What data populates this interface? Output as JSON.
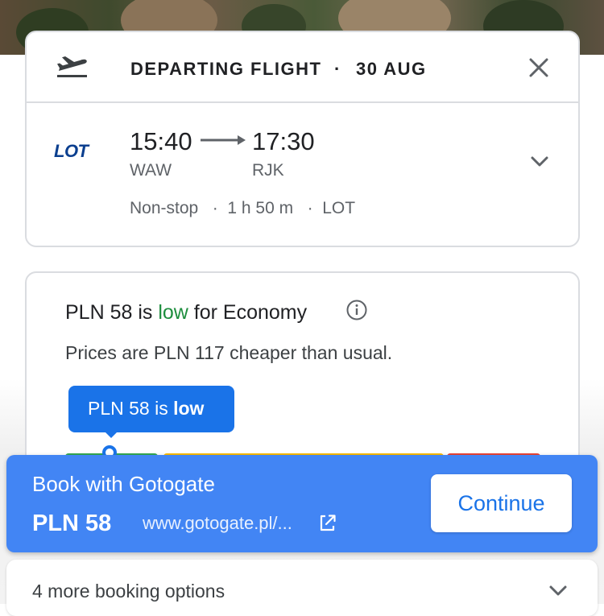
{
  "header": {
    "title": "DEPARTING FLIGHT",
    "separator": "·",
    "date": "30 AUG"
  },
  "flight": {
    "airline_logo_text": "LOT",
    "departure_time": "15:40",
    "arrival_time": "17:30",
    "departure_code": "WAW",
    "arrival_code": "RJK",
    "details": "Non-stop   ·  1 h 50 m   ·  LOT"
  },
  "price_insight": {
    "line1_prefix": "PLN 58 is ",
    "line1_status": "low",
    "line1_suffix": " for Economy",
    "line2": "Prices are PLN 117 cheaper than usual.",
    "tooltip_prefix": "PLN 58 is ",
    "tooltip_status": "low",
    "status_color": "#1e8e3e",
    "price_range_colors": [
      "#34a853",
      "#fbbc04",
      "#ea4335"
    ]
  },
  "booking": {
    "title": "Book with Gotogate",
    "price": "PLN 58",
    "url": "www.gotogate.pl/...",
    "continue_label": "Continue",
    "accent_color": "#4285f4"
  },
  "more_options": {
    "label": "4 more booking options"
  },
  "icons": {
    "departure": "flight-takeoff-icon",
    "close": "close-icon",
    "expand": "chevron-down-icon",
    "info": "info-icon",
    "open_external": "open-in-new-icon"
  }
}
